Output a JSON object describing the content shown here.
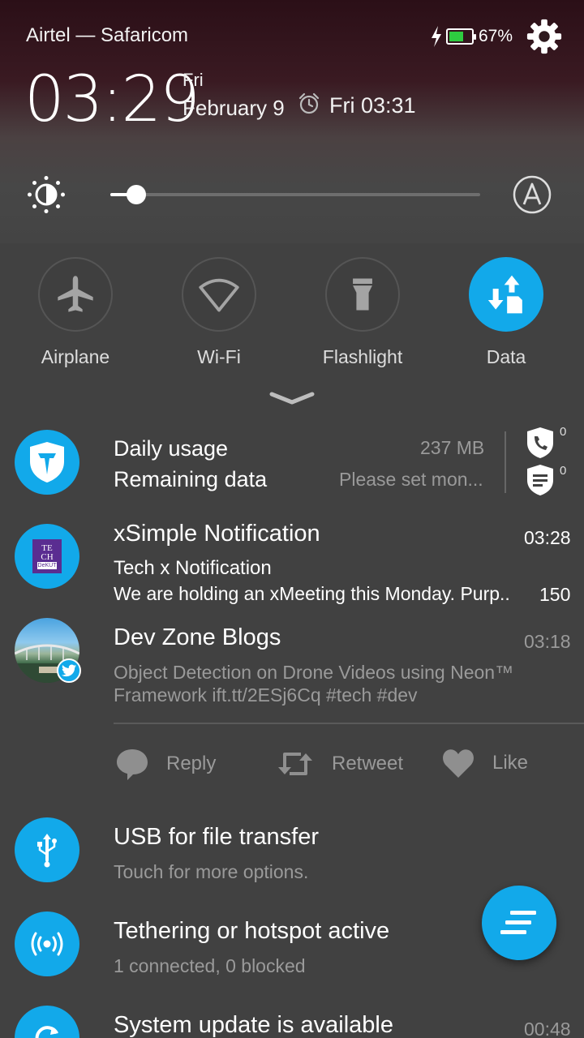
{
  "status_bar": {
    "carrier": "Airtel — Safaricom",
    "battery_percent": "67%",
    "battery_level": 0.67
  },
  "clock": {
    "hours": "03",
    "minutes": "29",
    "day": "Fri",
    "date": "February 9",
    "alarm": "Fri 03:31"
  },
  "brightness": {
    "level": 0.07
  },
  "toggles": [
    {
      "label": "Airplane",
      "icon": "airplane-icon",
      "active": false
    },
    {
      "label": "Wi-Fi",
      "icon": "wifi-icon",
      "active": false
    },
    {
      "label": "Flashlight",
      "icon": "flashlight-icon",
      "active": false
    },
    {
      "label": "Data",
      "icon": "mobile-data-icon",
      "active": true
    }
  ],
  "colors": {
    "accent": "#12a9ea",
    "background": "#414141"
  },
  "notifications": {
    "data_usage": {
      "title1": "Daily usage",
      "value1": "237 MB",
      "title2": "Remaining data",
      "value2": "Please set mon...",
      "calls_count": "0",
      "messages_count": "0"
    },
    "xsimple": {
      "title": "xSimple Notification",
      "time": "03:28",
      "subtitle": "Tech x Notification",
      "body": "We are holding an xMeeting this Monday. Purp..",
      "count": "150",
      "logo_text": "TECH DeKUT"
    },
    "devzone": {
      "title": "Dev Zone Blogs",
      "time": "03:18",
      "body_line1": "Object Detection on Drone Videos using Neon™",
      "body_line2": "Framework ift.tt/2ESj6Cq #tech #dev",
      "actions": {
        "reply": "Reply",
        "retweet": "Retweet",
        "like": "Like"
      }
    },
    "usb": {
      "title": "USB for file transfer",
      "subtitle": "Touch for more options."
    },
    "tethering": {
      "title": "Tethering or hotspot active",
      "subtitle": "1 connected, 0 blocked"
    },
    "system_update": {
      "title": "System update is available",
      "time": "00:48"
    }
  }
}
